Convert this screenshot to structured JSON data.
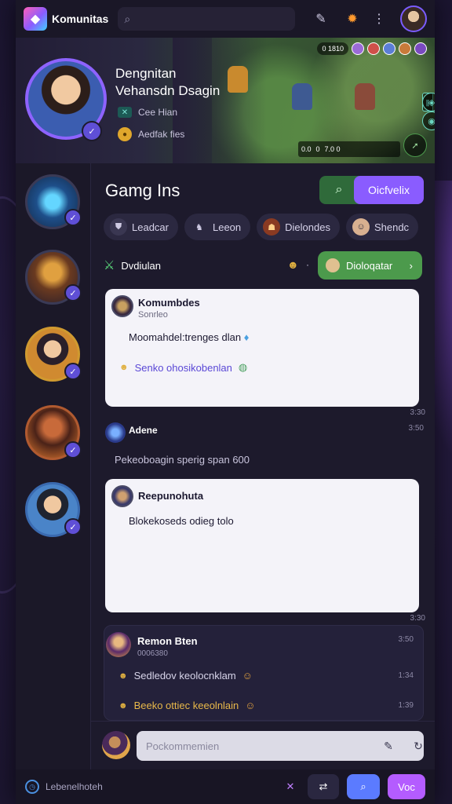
{
  "topbar": {
    "app_title": "Komunitas",
    "search_placeholder": "",
    "search_icon": "search-icon",
    "icons": [
      "edit-icon",
      "flame-icon",
      "more-vertical-icon"
    ]
  },
  "banner": {
    "name": "Dengnitan",
    "subtitle": "Vehansdn Dsagin",
    "meta": [
      {
        "icon": "controller-icon",
        "text": "Cee Hian"
      },
      {
        "icon": "coin-icon",
        "text": "Aedfak fies"
      }
    ],
    "hud_top": "0 1810",
    "hud_bottom": [
      "0.0",
      "0",
      "7.0 0"
    ]
  },
  "main": {
    "section_title": "Gamg Ins",
    "primary_button": "Oicfvelix",
    "chips": [
      {
        "icon": "shield-icon",
        "label": "Leadcar"
      },
      {
        "icon": "figure-icon",
        "label": "Leeon"
      },
      {
        "icon": "hero-icon",
        "label": "Dielondes"
      },
      {
        "icon": "avatar-icon",
        "label": "Shendc"
      }
    ],
    "division_label": "Dvdiulan",
    "division_button": "Dioloqatar"
  },
  "feed": {
    "card1": {
      "title": "Komumbdes",
      "subtitle": "Sonrleo",
      "body": "Moomahdel:trenges dlan",
      "link": "Senko ohosikobenlan",
      "time": "3:30"
    },
    "post": {
      "name": "Adene",
      "text": "Pekeoboagin sperig span 600",
      "time": "3:50"
    },
    "card2": {
      "title": "Reepunohuta",
      "body": "Blokekoseds odieg tolo",
      "time": "3:30"
    },
    "dark_card": {
      "name": "Remon Bten",
      "sub": "0006380",
      "time": "3:50",
      "lines": [
        {
          "text": "Sedledov keolocnklam",
          "time": "1:34",
          "color": "#d8d5ea"
        },
        {
          "text": "Beeko ottiec keeolnlain",
          "time": "1:39",
          "color": "#e8b84a"
        }
      ]
    }
  },
  "composer": {
    "placeholder": "Pockommemien"
  },
  "bottombar": {
    "text": "Lebenelhoteh",
    "button_label": "Voc"
  },
  "colors": {
    "accent": "#8a5cff",
    "green": "#4c9a4c",
    "background": "#1d1a2c"
  }
}
